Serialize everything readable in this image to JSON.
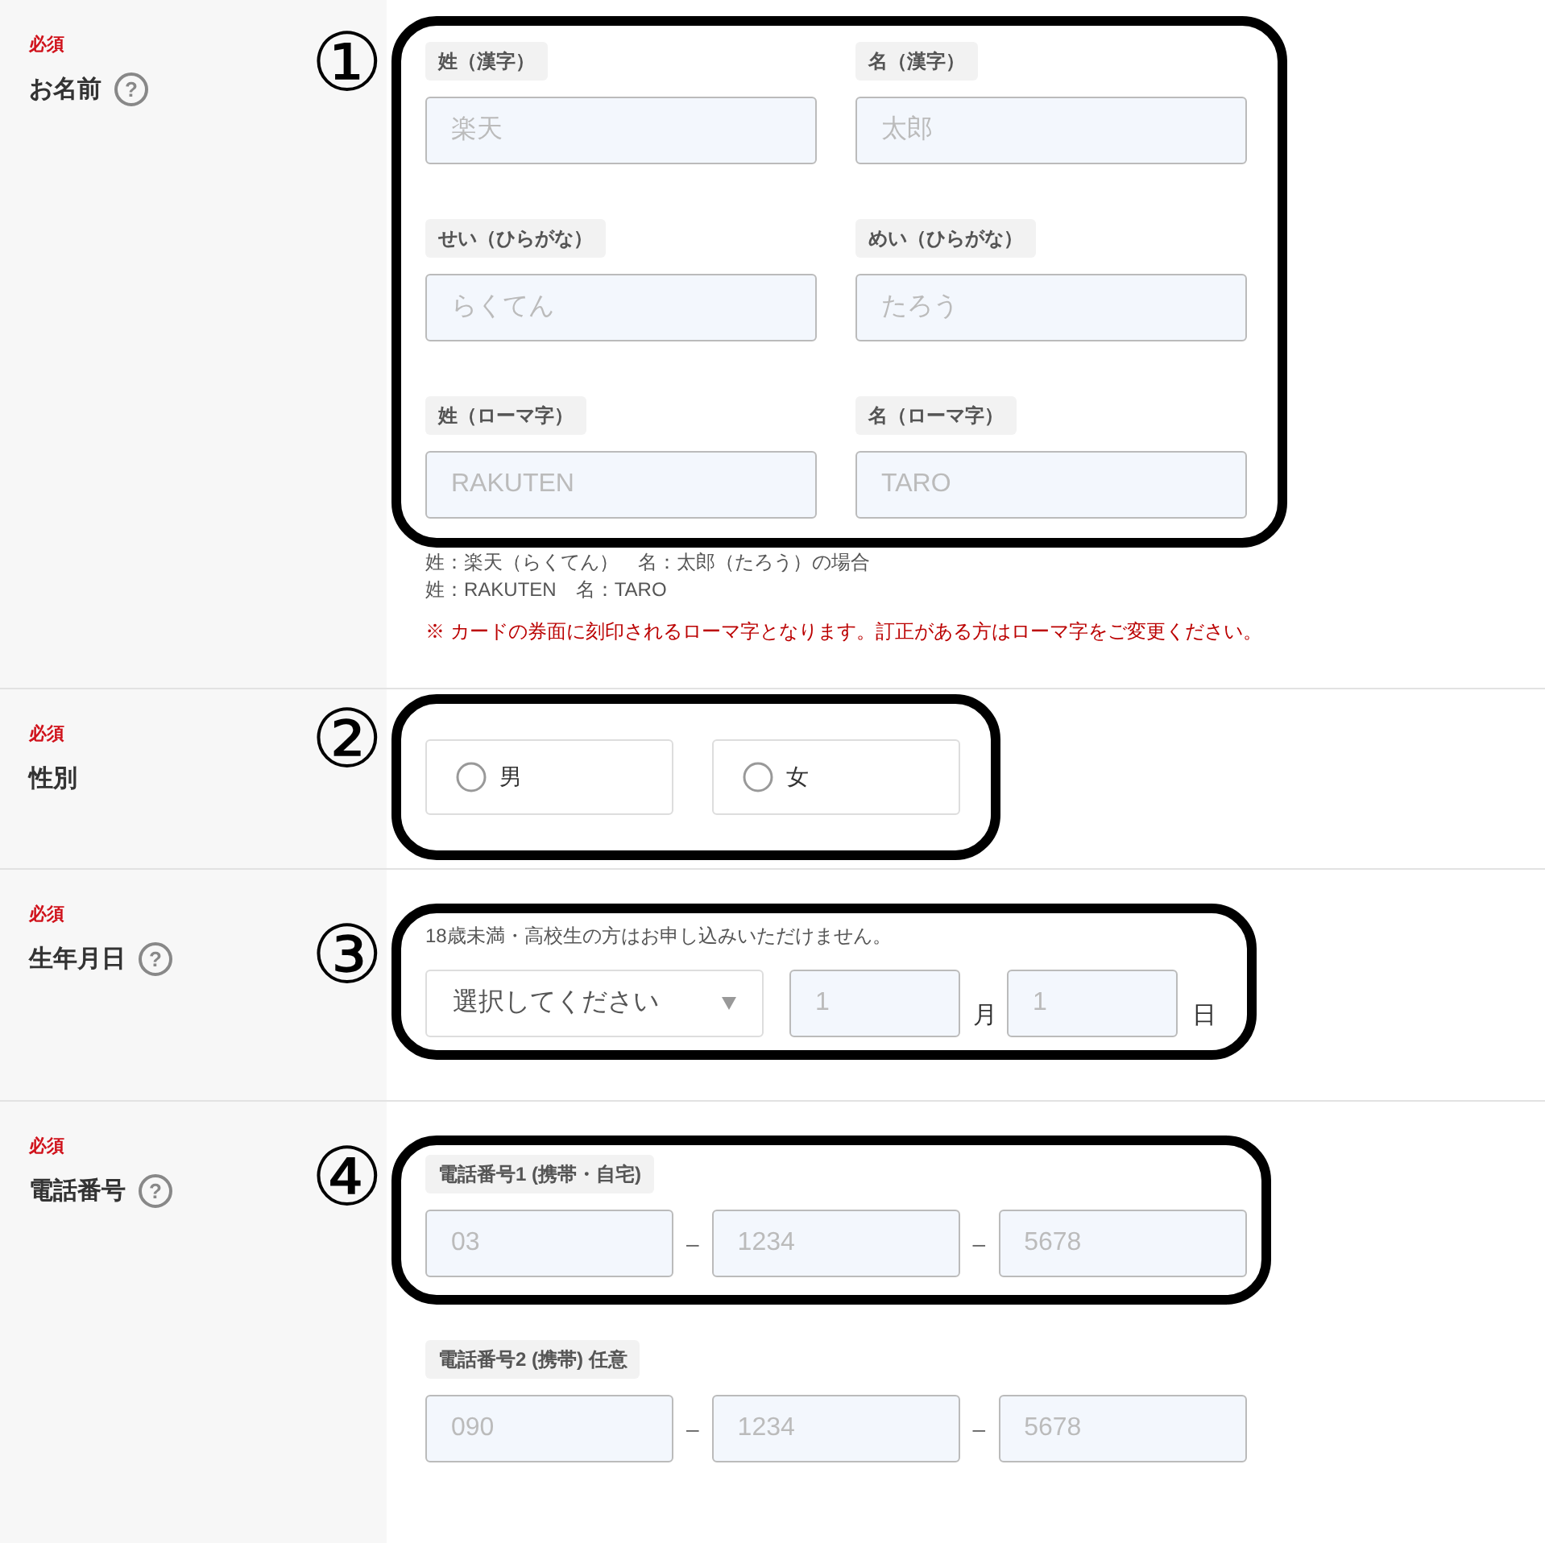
{
  "sections": [
    {
      "kind": "name",
      "required": "必須",
      "label": "お名前",
      "help": "?",
      "annotation": "①",
      "fields": [
        {
          "label": "姓（漢字）",
          "placeholder": "楽天"
        },
        {
          "label": "名（漢字）",
          "placeholder": "太郎"
        },
        {
          "label": "せい（ひらがな）",
          "placeholder": "らくてん"
        },
        {
          "label": "めい（ひらがな）",
          "placeholder": "たろう"
        },
        {
          "label": "姓（ローマ字）",
          "placeholder": "RAKUTEN"
        },
        {
          "label": "名（ローマ字）",
          "placeholder": "TARO"
        }
      ],
      "notes": [
        "姓：楽天（らくてん）　名：太郎（たろう）の場合",
        "姓：RAKUTEN　名：TARO"
      ],
      "warning": "※ カードの券面に刻印されるローマ字となります。訂正がある方はローマ字をご変更ください。"
    },
    {
      "kind": "radio",
      "required": "必須",
      "label": "性別",
      "annotation": "②",
      "options": [
        {
          "label": "男",
          "selected": false
        },
        {
          "label": "女",
          "selected": false
        }
      ]
    },
    {
      "kind": "date",
      "required": "必須",
      "label": "生年月日",
      "help": "?",
      "annotation": "③",
      "note": "18歳未満・高校生の方はお申し込みいただけません。",
      "select": {
        "placeholder": "選択してください"
      },
      "month": {
        "placeholder": "1",
        "unit": "月"
      },
      "day": {
        "placeholder": "1",
        "unit": "日"
      }
    },
    {
      "kind": "phone",
      "required": "必須",
      "label": "電話番号",
      "help": "?",
      "annotation": "④",
      "groups": [
        {
          "label": "電話番号1 (携帯・自宅)",
          "framed": true,
          "parts": [
            {
              "placeholder": "03"
            },
            {
              "placeholder": "1234"
            },
            {
              "placeholder": "5678"
            }
          ],
          "separators": [
            "–",
            "–"
          ]
        },
        {
          "label": "電話番号2 (携帯) 任意",
          "framed": false,
          "parts": [
            {
              "placeholder": "090"
            },
            {
              "placeholder": "1234"
            },
            {
              "placeholder": "5678"
            }
          ],
          "separators": [
            "–",
            "–"
          ]
        }
      ]
    }
  ]
}
